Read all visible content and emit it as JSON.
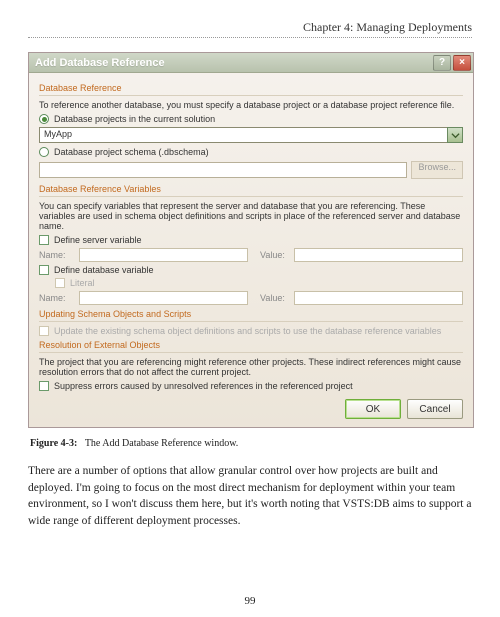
{
  "header": {
    "chapter": "Chapter 4: Managing Deployments"
  },
  "dialog": {
    "title": "Add Database Reference",
    "help_btn": "?",
    "close_btn": "×",
    "dbref": {
      "heading": "Database Reference",
      "instruction": "To reference another database, you must specify a database project or a database project reference file.",
      "radio_solution": "Database projects in the current solution",
      "combo_value": "MyApp",
      "radio_schema": "Database project schema (.dbschema)",
      "browse": "Browse..."
    },
    "vars": {
      "heading": "Database Reference Variables",
      "desc": "You can specify variables that represent the server and database that you are referencing. These variables are used in schema object definitions and scripts in place of the referenced server and database name.",
      "define_server": "Define server variable",
      "define_db": "Define database variable",
      "literal": "Literal",
      "name_label": "Name:",
      "value_label": "Value:"
    },
    "updating": {
      "heading": "Updating Schema Objects and Scripts",
      "desc": "Update the existing schema object definitions and scripts to use the database reference variables"
    },
    "resolution": {
      "heading": "Resolution of External Objects",
      "desc": "The project that you are referencing might reference other projects. These indirect references might cause resolution errors that do not affect the current project.",
      "suppress": "Suppress errors caused by unresolved references in the referenced project"
    },
    "buttons": {
      "ok": "OK",
      "cancel": "Cancel"
    }
  },
  "figure": {
    "label": "Figure 4-3:",
    "caption": "The Add Database Reference window."
  },
  "body": "There are a number of options that allow granular control over how projects are built and deployed. I'm going to focus on the most direct mechanism for deployment within your team environment, so I won't discuss them here, but it's worth noting that VSTS:DB aims to support a wide range of different deployment processes.",
  "page_number": "99"
}
